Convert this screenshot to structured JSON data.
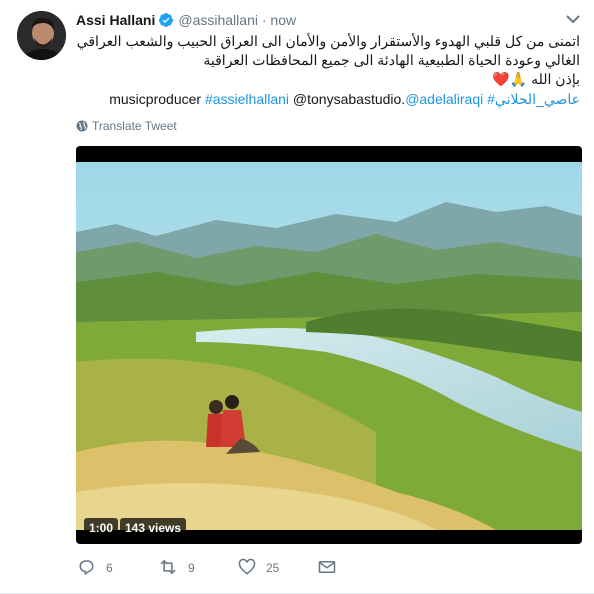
{
  "author": {
    "name": "Assi Hallani",
    "handle": "@assihallani",
    "separator": "·",
    "time": "now"
  },
  "tweet": {
    "text_ar_line1": "اتمنى من كل قلبي الهدوء والأستقرار والأمن والأمان الى العراق الحبيب والشعب العراقي الغالي وعودة الحياة الطبيعية الهادئة الى جميع المحافظات العراقية",
    "text_ar_line2": "بإذن الله",
    "emoji": "🙏❤️",
    "hashtag_ar": "#عاصي_الحلاني",
    "mention1": "@adelaliraqi",
    "mention2": "@tonysabastudio.",
    "hashtag_en": "#assielhallani",
    "producer_text": "musicproducer",
    "translate_label": "Translate Tweet"
  },
  "video": {
    "duration": "1:00",
    "views": "143 views"
  },
  "actions": {
    "replies": "6",
    "retweets": "9",
    "likes": "25"
  },
  "colors": {
    "link": "#1b95e0",
    "secondary_text": "#657786",
    "verified": "#1da1f2"
  }
}
